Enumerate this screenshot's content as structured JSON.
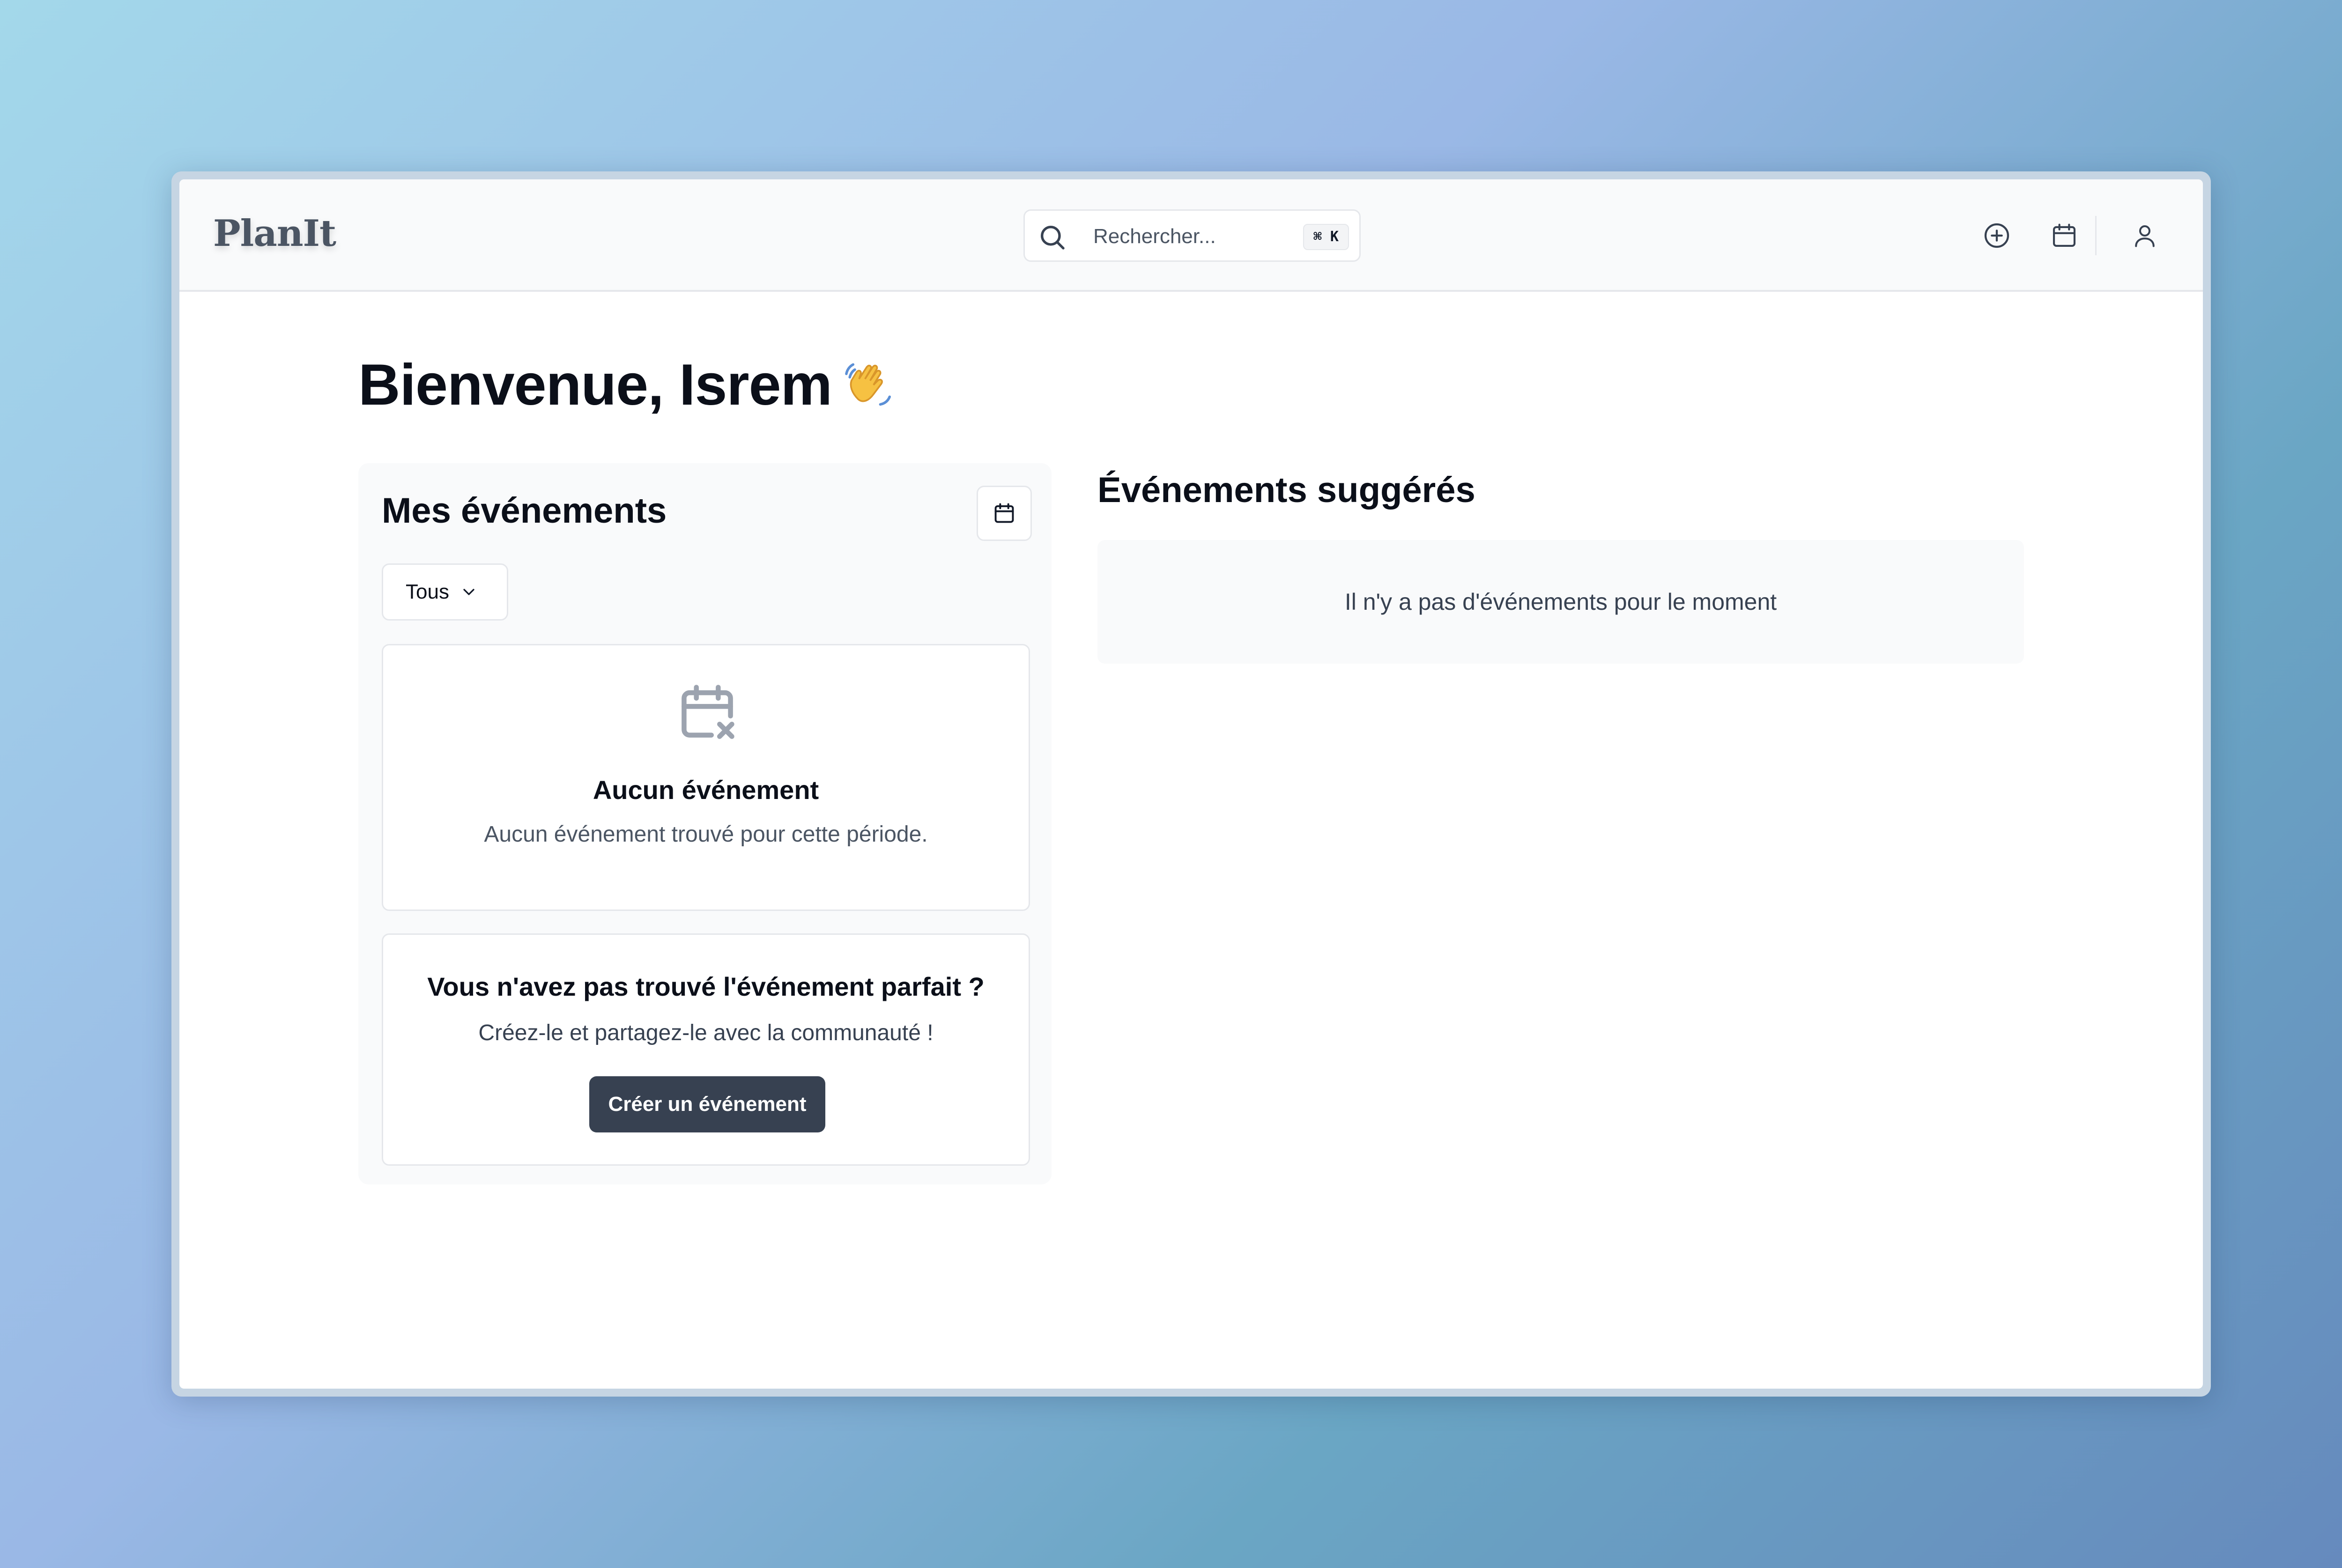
{
  "app": {
    "brand": "PlanIt"
  },
  "header": {
    "search": {
      "placeholder": "Rechercher...",
      "shortcut": "⌘ K"
    },
    "icons": [
      "plus-circle-icon",
      "calendar-icon",
      "user-icon"
    ]
  },
  "welcome": {
    "text": "Bienvenue, Isrem",
    "emoji": "waving-hand-icon"
  },
  "my_events": {
    "title": "Mes événements",
    "filter": {
      "selected": "Tous"
    },
    "empty": {
      "title": "Aucun événement",
      "text": "Aucun événement trouvé pour cette période."
    },
    "cta": {
      "title": "Vous n'avez pas trouvé l'événement parfait ?",
      "text": "Créez-le et partagez-le avec la communauté !",
      "button": "Créer un événement"
    }
  },
  "suggested": {
    "title": "Événements suggérés",
    "empty_text": "Il n'y a pas d'événements pour le moment"
  },
  "colors": {
    "primary_button": "#374151",
    "panel_bg": "#f9fafb",
    "border": "#e5e7eb",
    "text_muted": "#4b5563"
  }
}
